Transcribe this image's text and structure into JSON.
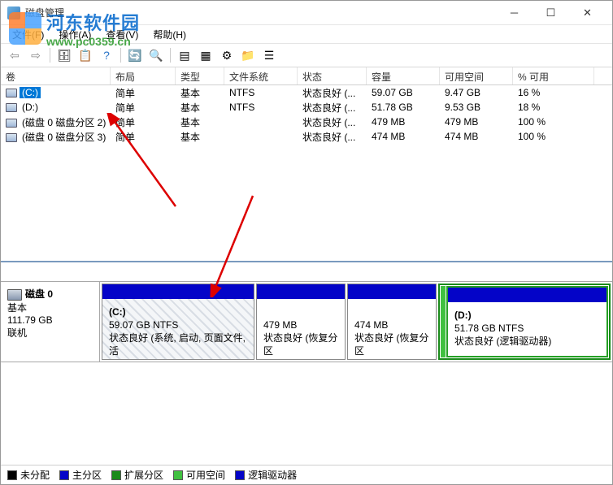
{
  "window": {
    "title": "磁盘管理"
  },
  "menu": {
    "file": "文件(F)",
    "action": "操作(A)",
    "view": "查看(V)",
    "help": "帮助(H)"
  },
  "watermark": {
    "title": "河东软件园",
    "url": "www.pc0359.cn"
  },
  "columns": {
    "volume": "卷",
    "layout": "布局",
    "type": "类型",
    "fs": "文件系统",
    "status": "状态",
    "capacity": "容量",
    "free": "可用空间",
    "pct": "% 可用"
  },
  "volumes": [
    {
      "name": "(C:)",
      "layout": "简单",
      "type": "基本",
      "fs": "NTFS",
      "status": "状态良好 (...",
      "capacity": "59.07 GB",
      "free": "9.47 GB",
      "pct": "16 %",
      "selected": true
    },
    {
      "name": "(D:)",
      "layout": "简单",
      "type": "基本",
      "fs": "NTFS",
      "status": "状态良好 (...",
      "capacity": "51.78 GB",
      "free": "9.53 GB",
      "pct": "18 %",
      "selected": false
    },
    {
      "name": "(磁盘 0 磁盘分区 2)",
      "layout": "简单",
      "type": "基本",
      "fs": "",
      "status": "状态良好 (...",
      "capacity": "479 MB",
      "free": "479 MB",
      "pct": "100 %",
      "selected": false
    },
    {
      "name": "(磁盘 0 磁盘分区 3)",
      "layout": "简单",
      "type": "基本",
      "fs": "",
      "status": "状态良好 (...",
      "capacity": "474 MB",
      "free": "474 MB",
      "pct": "100 %",
      "selected": false
    }
  ],
  "disk": {
    "label": "磁盘 0",
    "type": "基本",
    "size": "111.79 GB",
    "state": "联机"
  },
  "parts": {
    "p1": {
      "label": "(C:)",
      "size": "59.07 GB NTFS",
      "status": "状态良好 (系统, 启动, 页面文件, 活"
    },
    "p2": {
      "label": "",
      "size": "479 MB",
      "status": "状态良好 (恢复分区"
    },
    "p3": {
      "label": "",
      "size": "474 MB",
      "status": "状态良好 (恢复分区"
    },
    "p4": {
      "label": "(D:)",
      "size": "51.78 GB NTFS",
      "status": "状态良好 (逻辑驱动器)"
    }
  },
  "legend": {
    "unalloc": "未分配",
    "primary": "主分区",
    "extended": "扩展分区",
    "free": "可用空间",
    "logical": "逻辑驱动器"
  }
}
